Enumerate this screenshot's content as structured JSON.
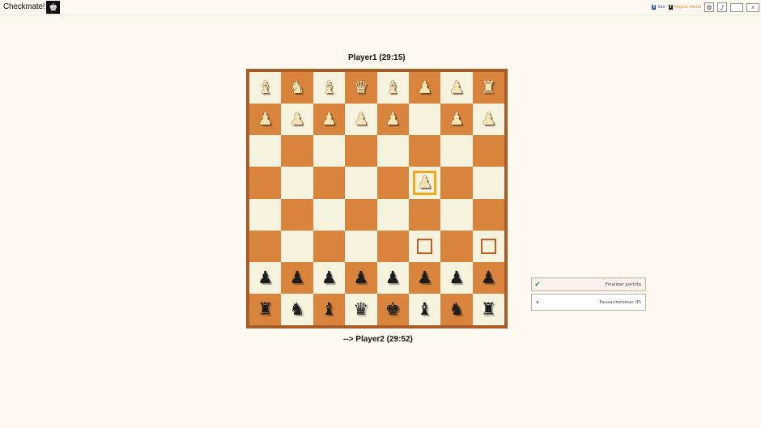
{
  "header": {
    "logo_text": "Checkmate!",
    "logo_icon": "chess-king-icon",
    "links": [
      {
        "label": "Site",
        "icon": "facebook-icon"
      },
      {
        "label": "Página oficial",
        "icon": "facebook-icon"
      }
    ],
    "buttons": [
      "settings-icon",
      "sound-icon",
      "window-box",
      "close-icon"
    ]
  },
  "game": {
    "top_player_label": "Player1 (29:15)",
    "bottom_player_label": "--> Player2 (29:52)"
  },
  "board": {
    "colors": {
      "light": "#f5f2dd",
      "dark": "#d9843d",
      "frame": "#a85c27",
      "selection": "#f2a61a",
      "hint": "#c65a1d"
    },
    "selected_square": "f5",
    "hint_squares": [
      "f3",
      "h3"
    ],
    "ranks_top_to_bottom": [
      [
        "wB",
        "wN",
        "wB",
        "wQ",
        "wB",
        "wP",
        "wP",
        "wR"
      ],
      [
        "wP",
        "wP",
        "wP",
        "wP",
        "wP",
        "",
        "wP",
        "wP"
      ],
      [
        "",
        "",
        "",
        "",
        "",
        "",
        "",
        ""
      ],
      [
        "",
        "",
        "",
        "",
        "",
        "wP",
        "",
        ""
      ],
      [
        "",
        "",
        "",
        "",
        "",
        "",
        "",
        ""
      ],
      [
        "",
        "",
        "",
        "",
        "",
        "",
        "",
        ""
      ],
      [
        "bP",
        "bP",
        "bP",
        "bP",
        "bP",
        "bP",
        "bP",
        "bP"
      ],
      [
        "bR",
        "bN",
        "bB",
        "bQ",
        "bK",
        "bB",
        "bN",
        "bR"
      ]
    ]
  },
  "panel": {
    "finish_label": "Finalizar partida",
    "pause_label": "Pausar/retomar (P)"
  }
}
